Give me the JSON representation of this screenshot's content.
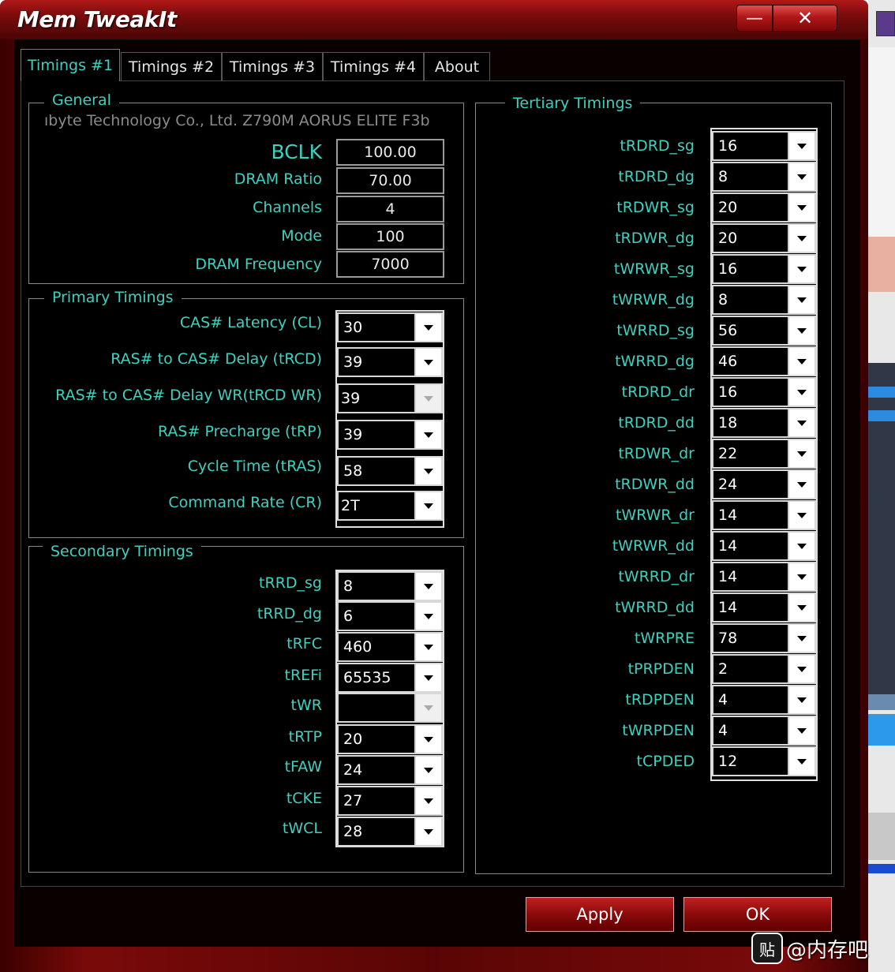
{
  "window": {
    "title": "Mem TweakIt",
    "minimize_label": "—",
    "close_label": "✕"
  },
  "tabs": [
    {
      "label": "Timings #1"
    },
    {
      "label": "Timings #2"
    },
    {
      "label": "Timings #3"
    },
    {
      "label": "Timings #4"
    },
    {
      "label": "About"
    }
  ],
  "general": {
    "title": "General",
    "motherboard": "ıbyte Technology Co., Ltd. Z790M AORUS ELITE F3b",
    "rows": [
      {
        "label": "BCLK",
        "value": "100.00"
      },
      {
        "label": "DRAM Ratio",
        "value": "70.00"
      },
      {
        "label": "Channels",
        "value": "4"
      },
      {
        "label": "Mode",
        "value": "100"
      },
      {
        "label": "DRAM Frequency",
        "value": "7000"
      }
    ]
  },
  "primary": {
    "title": "Primary Timings",
    "rows": [
      {
        "label": "CAS# Latency (CL)",
        "value": "30"
      },
      {
        "label": "RAS# to CAS# Delay (tRCD)",
        "value": "39"
      },
      {
        "label": "RAS# to CAS# Delay WR(tRCD WR)",
        "value": "39"
      },
      {
        "label": "RAS# Precharge (tRP)",
        "value": "39"
      },
      {
        "label": "Cycle Time (tRAS)",
        "value": "58"
      },
      {
        "label": "Command Rate (CR)",
        "value": "2T"
      }
    ]
  },
  "secondary": {
    "title": "Secondary Timings",
    "rows": [
      {
        "label": "tRRD_sg",
        "value": "8"
      },
      {
        "label": "tRRD_dg",
        "value": "6"
      },
      {
        "label": "tRFC",
        "value": "460"
      },
      {
        "label": "tREFi",
        "value": "65535"
      },
      {
        "label": "tWR",
        "value": ""
      },
      {
        "label": "tRTP",
        "value": "20"
      },
      {
        "label": "tFAW",
        "value": "24"
      },
      {
        "label": "tCKE",
        "value": "27"
      },
      {
        "label": "tWCL",
        "value": "28"
      }
    ]
  },
  "tertiary": {
    "title": "Tertiary Timings",
    "rows": [
      {
        "label": "tRDRD_sg",
        "value": "16"
      },
      {
        "label": "tRDRD_dg",
        "value": "8"
      },
      {
        "label": "tRDWR_sg",
        "value": "20"
      },
      {
        "label": "tRDWR_dg",
        "value": "20"
      },
      {
        "label": "tWRWR_sg",
        "value": "16"
      },
      {
        "label": "tWRWR_dg",
        "value": "8"
      },
      {
        "label": "tWRRD_sg",
        "value": "56"
      },
      {
        "label": "tWRRD_dg",
        "value": "46"
      },
      {
        "label": "tRDRD_dr",
        "value": "16"
      },
      {
        "label": "tRDRD_dd",
        "value": "18"
      },
      {
        "label": "tRDWR_dr",
        "value": "22"
      },
      {
        "label": "tRDWR_dd",
        "value": "24"
      },
      {
        "label": "tWRWR_dr",
        "value": "14"
      },
      {
        "label": "tWRWR_dd",
        "value": "14"
      },
      {
        "label": "tWRRD_dr",
        "value": "14"
      },
      {
        "label": "tWRRD_dd",
        "value": "14"
      },
      {
        "label": "tWRPRE",
        "value": "78"
      },
      {
        "label": "tPRPDEN",
        "value": "2"
      },
      {
        "label": "tRDPDEN",
        "value": "4"
      },
      {
        "label": "tWRPDEN",
        "value": "4"
      },
      {
        "label": "tCPDED",
        "value": "12"
      }
    ]
  },
  "buttons": {
    "apply": "Apply",
    "ok": "OK"
  },
  "watermark": "@内存吧",
  "colors": {
    "accent_text": "#3fd0c0",
    "frame_red": "#8a0a0a"
  }
}
